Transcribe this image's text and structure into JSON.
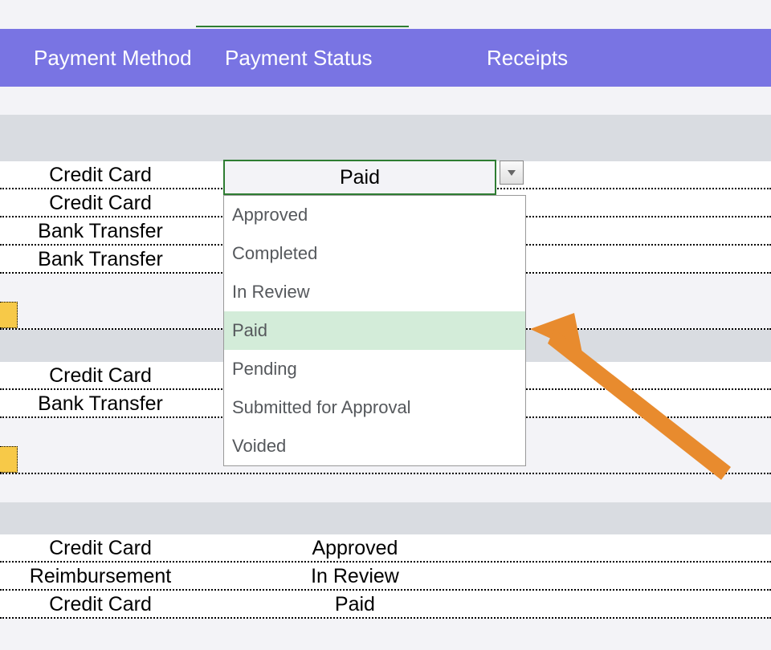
{
  "header": {
    "col1": "Payment Method",
    "col2": "Payment Status",
    "col3": "Receipts"
  },
  "rows": [
    {
      "method": "Credit Card",
      "status": "Paid"
    },
    {
      "method": "Credit Card",
      "status": ""
    },
    {
      "method": "Bank Transfer",
      "status": ""
    },
    {
      "method": "Bank Transfer",
      "status": ""
    },
    {
      "method": "Credit Card",
      "status": ""
    },
    {
      "method": "Bank Transfer",
      "status": ""
    },
    {
      "method": "Credit Card",
      "status": "Approved"
    },
    {
      "method": "Reimbursement",
      "status": "In Review"
    },
    {
      "method": "Credit Card",
      "status": "Paid"
    }
  ],
  "dropdown": {
    "selected": "Paid",
    "options": [
      "Approved",
      "Completed",
      "In Review",
      "Paid",
      "Pending",
      "Submitted for Approval",
      "Voided"
    ]
  },
  "annotation": {
    "arrow_color": "#e88b2e"
  }
}
